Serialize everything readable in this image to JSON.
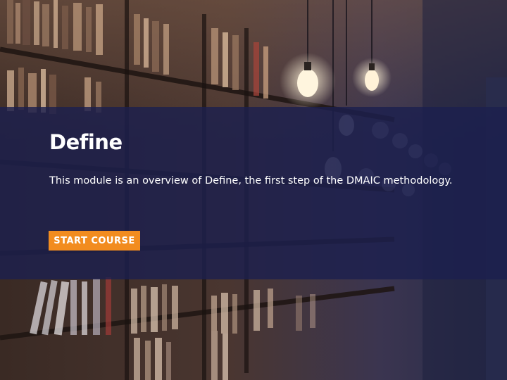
{
  "course": {
    "title": "Define",
    "description": "This module is an overview of Define, the first step of the DMAIC methodology.",
    "start_label": "START COURSE"
  },
  "colors": {
    "banner": "#1c204e",
    "button": "#f28c1f",
    "text": "#ffffff"
  }
}
